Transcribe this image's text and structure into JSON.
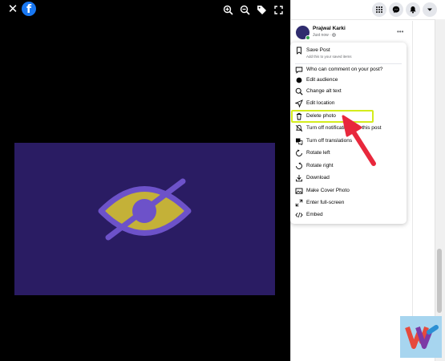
{
  "viewer": {
    "close_glyph": "✕",
    "logo_letter": "f",
    "tools": [
      "zoom-in-icon",
      "zoom-out-icon",
      "tag-icon",
      "fullscreen-icon"
    ]
  },
  "post": {
    "author": "Prajwal Karki",
    "time": "Just now · ",
    "more": "•••"
  },
  "menu": {
    "items": [
      {
        "name": "save-post",
        "icon": "bookmark-icon",
        "label": "Save Post",
        "sub": "Add this to your saved items"
      },
      {
        "name": "who-can-comment",
        "icon": "comment-icon",
        "label": "Who can comment on your post?"
      },
      {
        "name": "edit-audience",
        "icon": "globe-icon",
        "label": "Edit audience"
      },
      {
        "name": "change-alt-text",
        "icon": "search-icon",
        "label": "Change alt text"
      },
      {
        "name": "edit-location",
        "icon": "location-arrow-icon",
        "label": "Edit location"
      },
      {
        "name": "delete-photo",
        "icon": "trash-icon",
        "label": "Delete photo"
      },
      {
        "name": "turn-off-notifications",
        "icon": "bell-off-icon",
        "label": "Turn off notifications for this post"
      },
      {
        "name": "turn-off-translations",
        "icon": "translate-icon",
        "label": "Turn off translations"
      },
      {
        "name": "rotate-left",
        "icon": "rotate-left-icon",
        "label": "Rotate left"
      },
      {
        "name": "rotate-right",
        "icon": "rotate-right-icon",
        "label": "Rotate right"
      },
      {
        "name": "download",
        "icon": "download-icon",
        "label": "Download"
      },
      {
        "name": "make-cover-photo",
        "icon": "image-icon",
        "label": "Make Cover Photo"
      },
      {
        "name": "enter-full-screen",
        "icon": "expand-icon",
        "label": "Enter full-screen"
      },
      {
        "name": "embed",
        "icon": "code-icon",
        "label": "Embed"
      }
    ]
  },
  "colors": {
    "facebook_blue": "#1877f2",
    "image_bg": "#2a1c63",
    "eye_fill": "#c4b138",
    "eye_stroke": "#6d52c9",
    "highlight": "#d4ec1d",
    "arrow": "#ee3345"
  },
  "image": {
    "icon": "eye-slash-icon"
  }
}
